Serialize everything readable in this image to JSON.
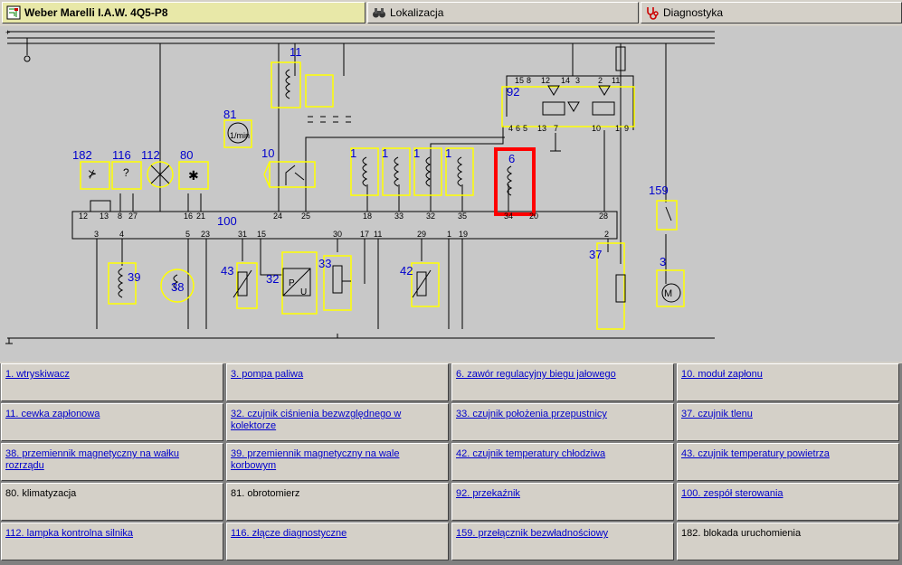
{
  "tabs": [
    {
      "label": "Weber Marelli I.A.W. 4Q5-P8",
      "icon": "wiring-diagram-icon",
      "active": true
    },
    {
      "label": "Lokalizacja",
      "icon": "binoculars-icon",
      "active": false
    },
    {
      "label": "Diagnostyka",
      "icon": "stethoscope-icon",
      "active": false
    }
  ],
  "diagram": {
    "component_labels": {
      "c11": "11",
      "c81": "81",
      "c92": "92",
      "c182": "182",
      "c116": "116",
      "c112": "112",
      "c80": "80",
      "c10": "10",
      "c1a": "1",
      "c1b": "1",
      "c1c": "1",
      "c1d": "1",
      "c6": "6",
      "c159": "159",
      "c100": "100",
      "c39": "39",
      "c38": "38",
      "c43": "43",
      "c32": "32",
      "c33": "33",
      "c42": "42",
      "c37": "37",
      "c3": "3"
    },
    "ecu_pins_top": [
      "12",
      "13",
      "8",
      "27",
      "16",
      "21",
      "24",
      "25",
      "18",
      "33",
      "32",
      "35",
      "34",
      "20",
      "28"
    ],
    "ecu_pins_bottom": [
      "3",
      "4",
      "5",
      "23",
      "31",
      "15",
      "30",
      "17",
      "11",
      "29",
      "1",
      "19",
      "2"
    ],
    "relay_pins": [
      "15",
      "8",
      "12",
      "14",
      "3",
      "2",
      "11",
      "4",
      "6",
      "5",
      "13",
      "7",
      "10",
      "1",
      "9"
    ],
    "tacho_unit": "1/min",
    "highlight_color": "#ff0000",
    "wire_color": "#000000",
    "outline_color": "#ffff00",
    "label_color": "#0000cc"
  },
  "legend": [
    {
      "text": "1. wtryskiwacz",
      "link": true
    },
    {
      "text": "3. pompa paliwa",
      "link": true
    },
    {
      "text": "6. zawór regulacyjny biegu jałowego",
      "link": true
    },
    {
      "text": "10. moduł zapłonu",
      "link": true
    },
    {
      "text": "11. cewka zapłonowa",
      "link": true
    },
    {
      "text": "32. czujnik ciśnienia bezwzględnego w kolektorze",
      "link": true
    },
    {
      "text": "33. czujnik położenia przepustnicy",
      "link": true
    },
    {
      "text": "37. czujnik tlenu",
      "link": true
    },
    {
      "text": "38. przemiennik magnetyczny na wałku rozrządu",
      "link": true
    },
    {
      "text": "39. przemiennik magnetyczny na wale korbowym",
      "link": true
    },
    {
      "text": "42. czujnik temperatury chłodziwa",
      "link": true
    },
    {
      "text": "43. czujnik temperatury powietrza",
      "link": true
    },
    {
      "text": "80. klimatyzacja",
      "link": false
    },
    {
      "text": "81. obrotomierz",
      "link": false
    },
    {
      "text": "92. przekaźnik",
      "link": true
    },
    {
      "text": "100. zespół sterowania",
      "link": true
    },
    {
      "text": "112. lampka kontrolna silnika",
      "link": true
    },
    {
      "text": "116. złącze diagnostyczne",
      "link": true
    },
    {
      "text": "159. przełącznik bezwładnościowy",
      "link": true
    },
    {
      "text": "182. blokada uruchomienia",
      "link": false
    }
  ]
}
